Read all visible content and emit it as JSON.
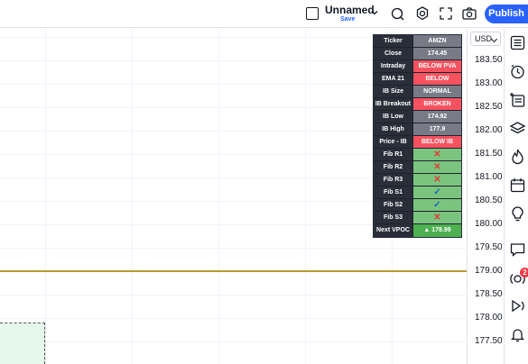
{
  "topbar": {
    "layout_name": "Unnamed",
    "save_label": "Save",
    "publish_label": "Publish"
  },
  "axis": {
    "currency": "USD",
    "ticks": [
      "183.50",
      "183.00",
      "182.50",
      "182.00",
      "181.50",
      "181.00",
      "180.50",
      "180.00",
      "179.50",
      "179.00",
      "178.50",
      "178.00",
      "177.50"
    ]
  },
  "table": {
    "rows": [
      {
        "label": "Ticker",
        "value": "AMZN",
        "style": "gray"
      },
      {
        "label": "Close",
        "value": "174.45",
        "style": "gray"
      },
      {
        "label": "Intraday",
        "value": "BELOW PVA",
        "style": "red"
      },
      {
        "label": "EMA 21",
        "value": "BELOW",
        "style": "red"
      },
      {
        "label": "IB Size",
        "value": "NORMAL",
        "style": "gray"
      },
      {
        "label": "IB Breakout",
        "value": "BROKEN DOWN",
        "style": "red"
      },
      {
        "label": "IB Low",
        "value": "174.92",
        "style": "gray"
      },
      {
        "label": "IB High",
        "value": "177.9",
        "style": "gray"
      },
      {
        "label": "Price - IB",
        "value": "BELOW IB",
        "style": "red"
      },
      {
        "label": "Fib R1",
        "value": "✕",
        "style": "green-x"
      },
      {
        "label": "Fib R2",
        "value": "✕",
        "style": "green-x"
      },
      {
        "label": "Fib R3",
        "value": "✕",
        "style": "green-x"
      },
      {
        "label": "Fib S1",
        "value": "✓",
        "style": "green-check"
      },
      {
        "label": "Fib S2",
        "value": "✓",
        "style": "green-check"
      },
      {
        "label": "Fib S3",
        "value": "✕",
        "style": "green-x"
      },
      {
        "label": "Next VPOC",
        "value": "▲ 178.99",
        "style": "greendk"
      }
    ]
  },
  "rightbar": {
    "notification_count": "2"
  },
  "colors": {
    "accent": "#2962ff",
    "line": "#b79b2f",
    "red": "#f7525f",
    "green": "#7bc47f"
  }
}
